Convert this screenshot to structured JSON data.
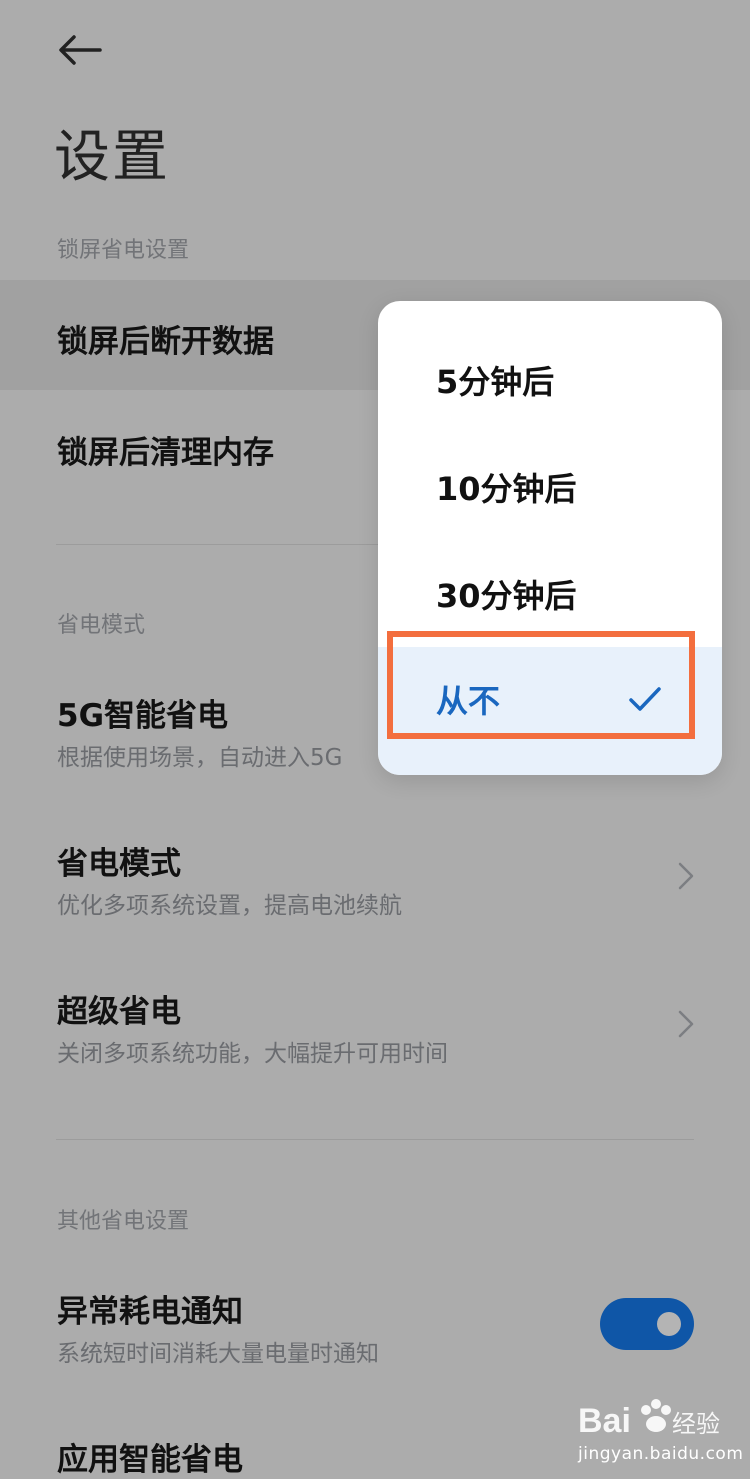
{
  "header": {
    "back_icon": "back-arrow-icon",
    "title": "设置"
  },
  "sections": {
    "lock_screen": {
      "label": "锁屏省电设置",
      "items": [
        {
          "title": "锁屏后断开数据"
        },
        {
          "title": "锁屏后清理内存"
        }
      ]
    },
    "power_mode": {
      "label": "省电模式",
      "items": [
        {
          "title": "5G智能省电",
          "subtitle": "根据使用场景，自动进入5G"
        },
        {
          "title": "省电模式",
          "subtitle": "优化多项系统设置，提高电池续航",
          "icon": "chevron-right-icon"
        },
        {
          "title": "超级省电",
          "subtitle": "关闭多项系统功能，大幅提升可用时间",
          "icon": "chevron-right-icon"
        }
      ]
    },
    "other": {
      "label": "其他省电设置",
      "items": [
        {
          "title": "异常耗电通知",
          "subtitle": "系统短时间消耗大量电量时通知",
          "toggle_on": true
        },
        {
          "title": "应用智能省电"
        }
      ]
    }
  },
  "dropdown": {
    "options": [
      {
        "label": "5分钟后",
        "selected": false
      },
      {
        "label": "10分钟后",
        "selected": false
      },
      {
        "label": "30分钟后",
        "selected": false
      },
      {
        "label": "从不",
        "selected": true
      }
    ],
    "check_icon": "checkmark-icon"
  },
  "colors": {
    "accent": "#1a67bf",
    "toggle": "#0f56a7",
    "annotation": "#f36e3e"
  },
  "watermark": {
    "brand": "Bai 经验",
    "url": "jingyan.baidu.com"
  }
}
